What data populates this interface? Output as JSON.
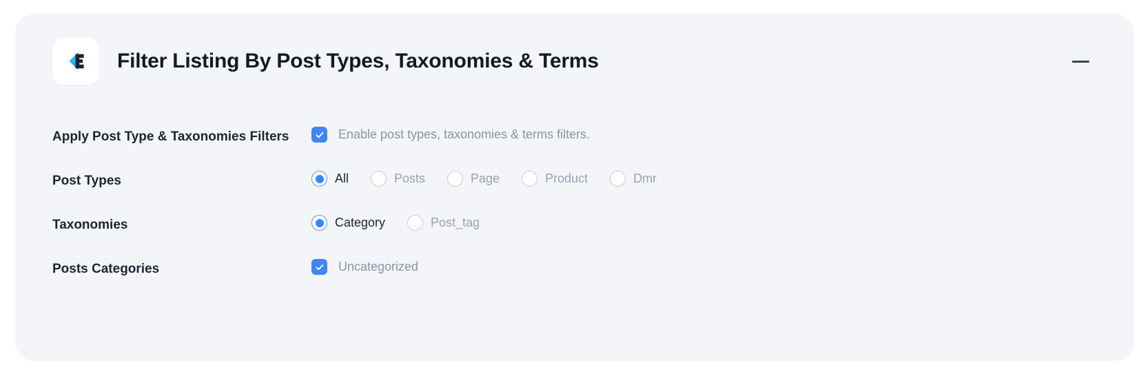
{
  "card": {
    "title": "Filter Listing By Post Types, Taxonomies & Terms",
    "logo_icon": "chevron-left-e-logo-icon",
    "collapse_icon": "minus-icon",
    "accent_color": "#4285f4",
    "background_color": "#f4f5f9"
  },
  "fields": {
    "apply_filters": {
      "label": "Apply Post Type & Taxonomies Filters",
      "checkbox": {
        "label": "Enable post types, taxonomies & terms filters.",
        "checked": true
      }
    },
    "post_types": {
      "label": "Post Types",
      "options": [
        {
          "label": "All",
          "selected": true
        },
        {
          "label": "Posts",
          "selected": false
        },
        {
          "label": "Page",
          "selected": false
        },
        {
          "label": "Product",
          "selected": false
        },
        {
          "label": "Dmr",
          "selected": false
        }
      ]
    },
    "taxonomies": {
      "label": "Taxonomies",
      "options": [
        {
          "label": "Category",
          "selected": true
        },
        {
          "label": "Post_tag",
          "selected": false
        }
      ]
    },
    "posts_categories": {
      "label": "Posts Categories",
      "checkbox": {
        "label": "Uncategorized",
        "checked": true
      }
    }
  }
}
